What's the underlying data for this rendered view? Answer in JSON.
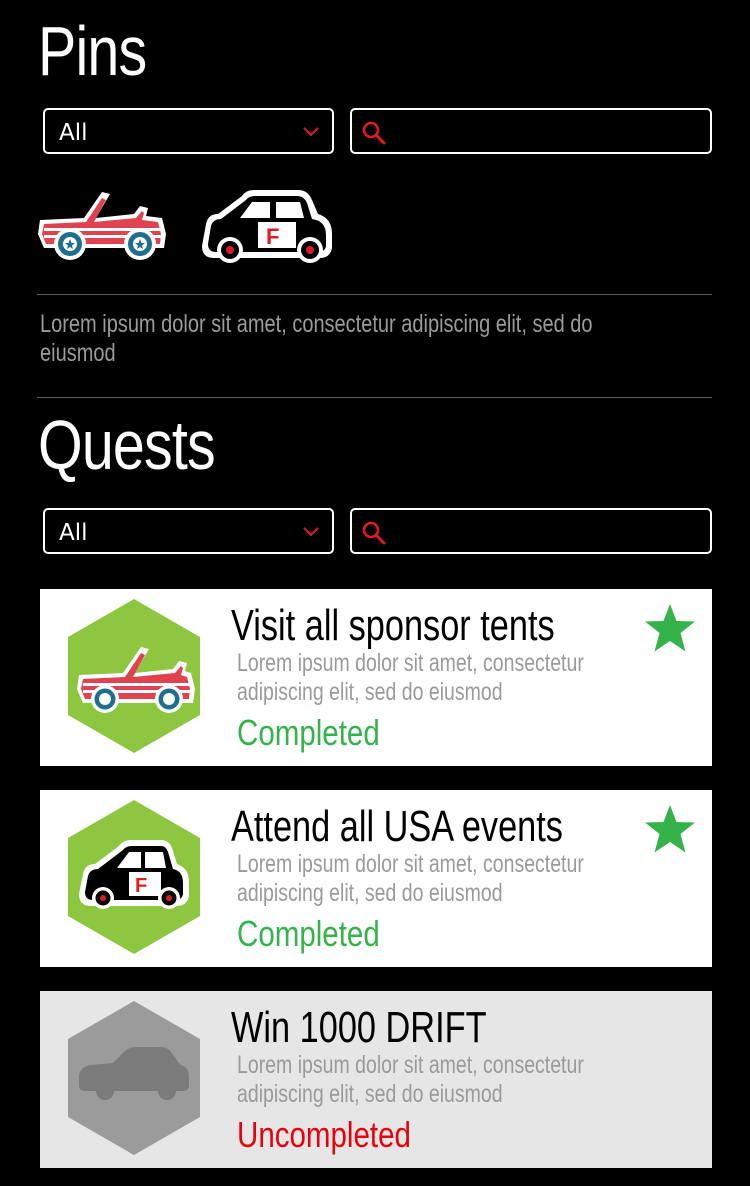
{
  "pins": {
    "title": "Pins",
    "filter": {
      "selected": "All"
    },
    "search": {
      "placeholder": ""
    },
    "items": [
      {
        "icon": "convertible-car-pin-icon"
      },
      {
        "icon": "jeep-pin-icon"
      }
    ],
    "description": "Lorem ipsum dolor sit amet, consectetur adipiscing elit, sed do eiusmod"
  },
  "quests": {
    "title": "Quests",
    "filter": {
      "selected": "All"
    },
    "search": {
      "placeholder": ""
    },
    "items": [
      {
        "title": "Visit all sponsor tents",
        "description": "Lorem ipsum dolor sit amet, consectetur adipiscing elit, sed do eiusmod",
        "status": "Completed",
        "icon": "convertible-car-icon",
        "starred": true
      },
      {
        "title": "Attend all USA events",
        "description": "Lorem ipsum dolor sit amet, consectetur adipiscing elit, sed do eiusmod",
        "status": "Completed",
        "icon": "jeep-icon",
        "starred": true
      },
      {
        "title": "Win 1000 DRIFT",
        "description": "Lorem ipsum dolor sit amet, consectetur adipiscing elit, sed do eiusmod",
        "status": "Uncompleted",
        "icon": "sedan-silhouette-icon",
        "starred": false
      }
    ]
  },
  "colors": {
    "background": "#000000",
    "accent_red": "#e01b22",
    "completed_green": "#34b34a",
    "uncompleted_red": "#e8000b",
    "hex_green": "#8dc63f",
    "hex_locked_gray": "#9b9b9b"
  }
}
